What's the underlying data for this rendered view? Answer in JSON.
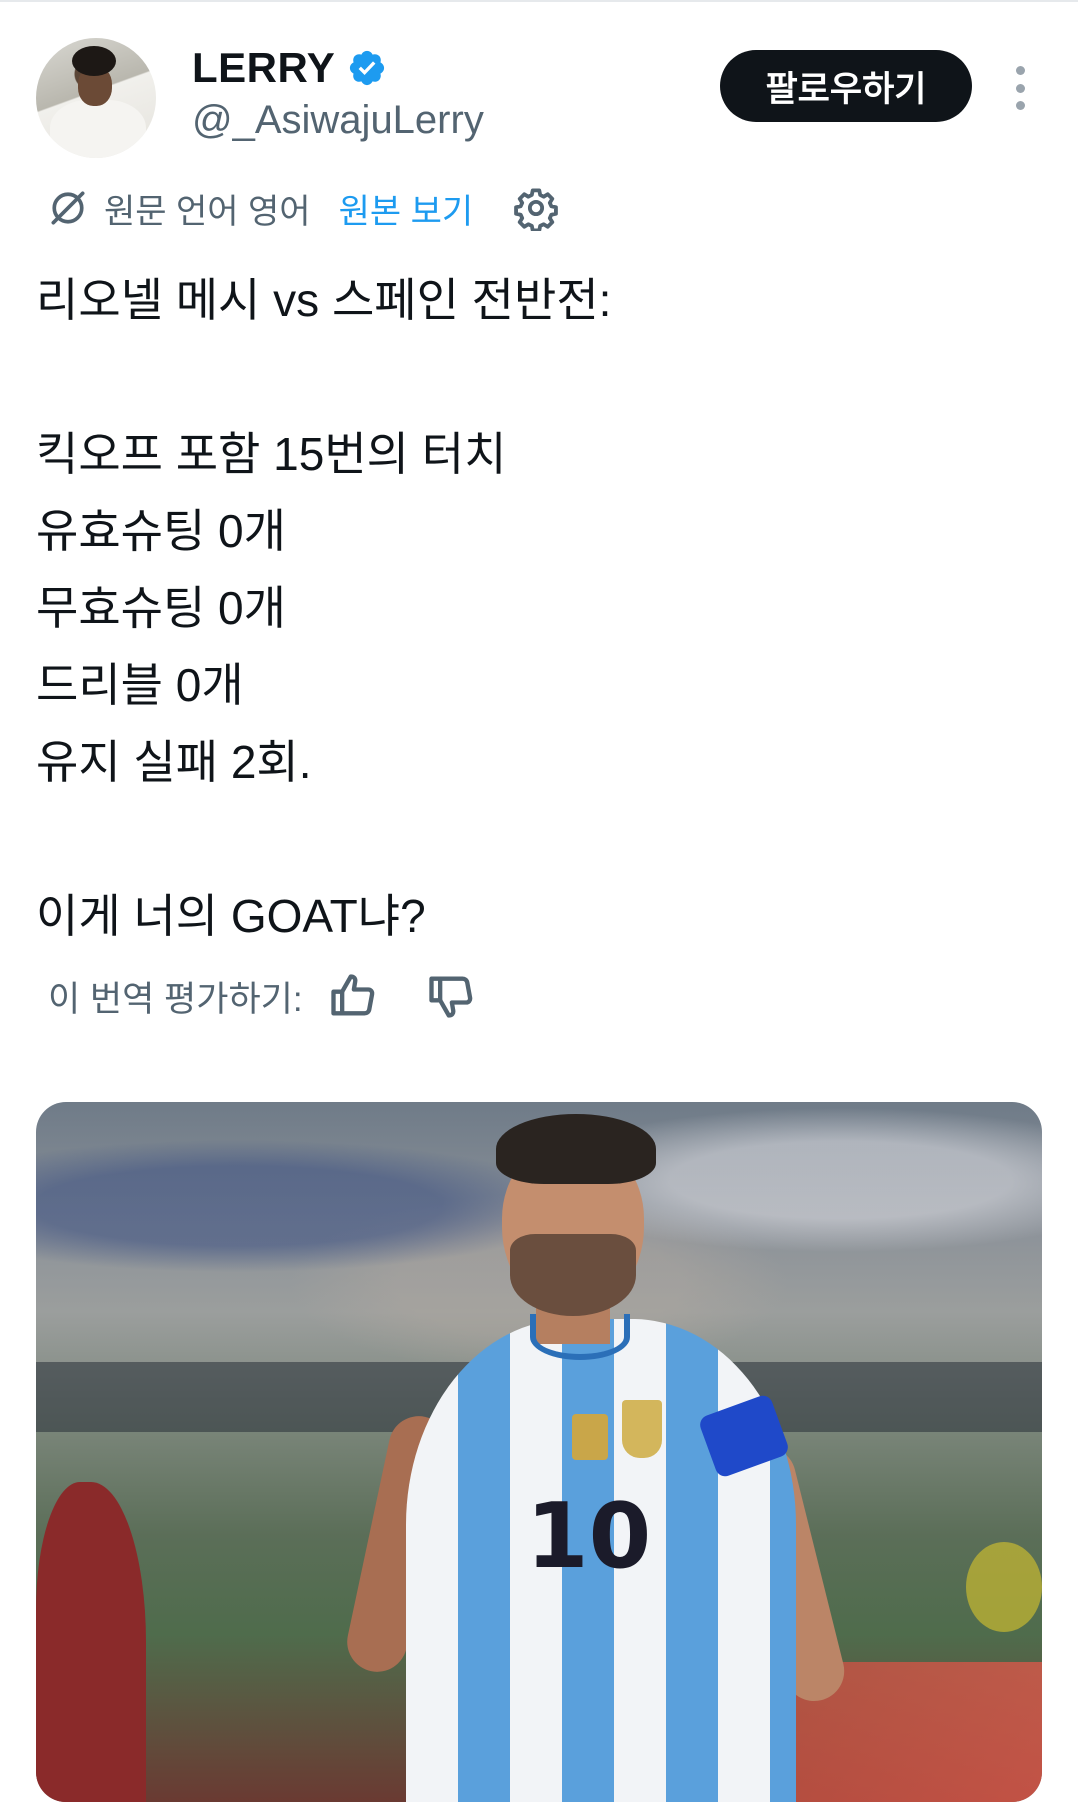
{
  "user": {
    "display_name": "LERRY",
    "handle": "@_AsiwajuLerry",
    "verified": true
  },
  "header": {
    "follow_label": "팔로우하기",
    "more_icon": "more-vertical-icon"
  },
  "translation": {
    "source_label": "원문 언어 영어",
    "show_original_label": "원본 보기",
    "rate_label": "이 번역 평가하기:"
  },
  "tweet": {
    "lines": [
      "리오넬 메시 vs 스페인 전반전:",
      "",
      "킥오프 포함 15번의 터치",
      "유효슈팅 0개",
      "무효슈팅 0개",
      "드리블 0개",
      "유지 실패 2회.",
      "",
      "이게 너의 GOAT냐?"
    ]
  },
  "media": {
    "jersey_number": "10"
  },
  "colors": {
    "link": "#1d9bf0",
    "verified": "#1d9bf0",
    "secondary_text": "#536471",
    "button_bg": "#0f1419"
  }
}
